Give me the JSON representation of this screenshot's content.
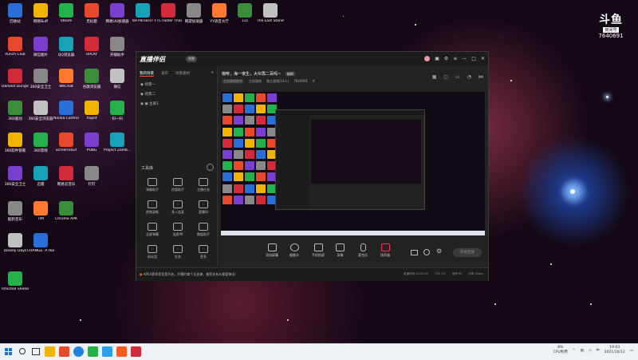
{
  "desktop": {
    "icons": [
      [
        "回收站",
        "网易Buff",
        "Steam",
        "无标题",
        "网易UU加速器",
        "60 Parsecs!",
        "FTL Faster Than Light",
        "网游加速器",
        "YY语音大厅",
        "111",
        "The Last Stand A..."
      ],
      [
        "Punch Club",
        "微信图片",
        "QQ浏览器",
        "UPLAY",
        "开播助手"
      ],
      [
        "Darkest Dungeon",
        "360安全卫士",
        "WeChat",
        "谷歌浏览器",
        "微信"
      ],
      [
        "360驱动",
        "360安全浏览器",
        "Nvidia Control",
        "XSplit",
        "扫一扫"
      ],
      [
        "360软件管家",
        "360游戏",
        "ScreenToGif",
        "PUBG",
        "Project Zomb..."
      ],
      [
        "360安全卫士",
        "迅雷",
        "网易云音乐",
        "钉钉"
      ],
      [
        "酷狗音乐",
        "TIM",
        "Chrome APK"
      ],
      [
        "Deadly Days",
        "CHANGE: A Homeless..."
      ],
      [
        "Infected Shelter"
      ]
    ]
  },
  "room": {
    "logo": "斗鱼",
    "label": "房间号",
    "number": "7640691"
  },
  "app": {
    "brand": "直播伴侣",
    "badge": "免费",
    "sidebar_tabs": [
      "我的场景",
      "发布",
      "场景素材"
    ],
    "scenes": [
      "场景一",
      "场景二",
      "主屏1"
    ],
    "tools_title": "工具库",
    "tools": [
      "弹幕助手",
      "房管助手",
      "主播任务",
      "视频录制",
      "多人连麦",
      "直播间",
      "全屏弹幕",
      "连麦PK",
      "数据助手",
      "粉丝团",
      "任务",
      "更多"
    ],
    "stream_title": "咖啡，海一夜生，大伙再二百吗~",
    "stream_tag": "编辑",
    "sub_info": [
      "主机游戏综合",
      "主机游戏",
      "独立游戏(14人)",
      "7640691",
      "0"
    ],
    "controls": [
      "添加屏幕",
      "摄像头",
      "手机投屏",
      "录像",
      "麦克风",
      "扬声器"
    ],
    "start_live": "开始直播",
    "status_msg": "APEX赛季是否是开启，开播时拿个无逃课，推荐还有头都要弹出!",
    "status_right": [
      "直播时间 00:00:00",
      "CPU 5%",
      "帧率 60",
      "码率 0kbps"
    ]
  },
  "taskbar": {
    "cpu_pct": "8%",
    "cpu_label": "CPU利用",
    "time": "19:03",
    "date": "2021/10/12",
    "lang": "中"
  },
  "colors": {
    "accent": "#ff5a1e",
    "win_bg": "#232324"
  }
}
